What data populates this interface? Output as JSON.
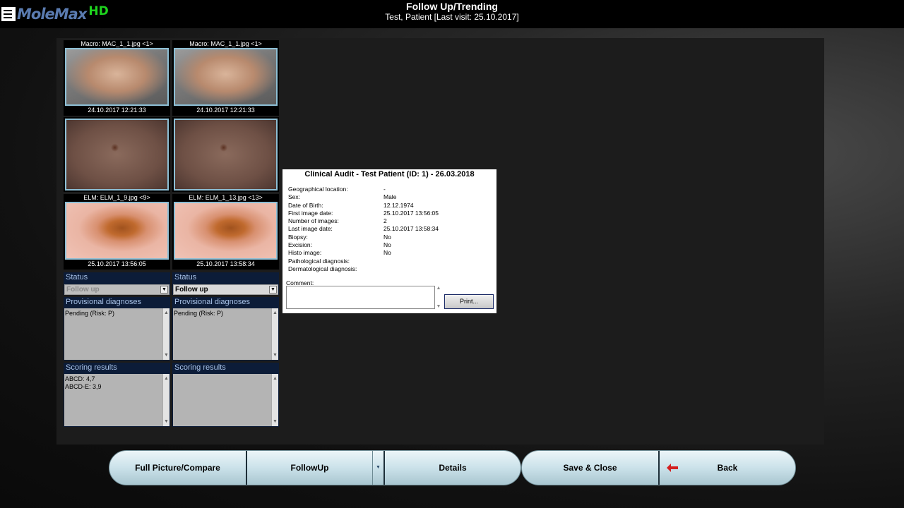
{
  "header": {
    "logo_text": "MoleMax",
    "logo_hd": "HD",
    "title": "Follow Up/Trending",
    "subtitle": "Test, Patient [Last visit: 25.10.2017]"
  },
  "columns": [
    {
      "macro_label": "Macro: MAC_1_1.jpg <1>",
      "macro_date": "24.10.2017 12:21:33",
      "elm_label": "ELM: ELM_1_9.jpg <9>",
      "elm_date": "25.10.2017 13:56:05",
      "status_heading": "Status",
      "status_value": "Follow up",
      "prov_heading": "Provisional diagnoses",
      "prov_text": "Pending (Risk: P)",
      "scoring_heading": "Scoring results",
      "scoring_lines": [
        "ABCD: 4,7",
        "ABCD-E: 3,9"
      ]
    },
    {
      "macro_label": "Macro: MAC_1_1.jpg <1>",
      "macro_date": "24.10.2017 12:21:33",
      "elm_label": "ELM: ELM_1_13.jpg <13>",
      "elm_date": "25.10.2017 13:58:34",
      "status_heading": "Status",
      "status_value": "Follow up",
      "prov_heading": "Provisional diagnoses",
      "prov_text": "Pending (Risk: P)",
      "scoring_heading": "Scoring results",
      "scoring_lines": [
        "",
        ""
      ]
    }
  ],
  "audit": {
    "title": "Clinical Audit - Test Patient (ID: 1) - 26.03.2018",
    "rows": [
      {
        "key": "Geographical location:",
        "value": "-"
      },
      {
        "key": "Sex:",
        "value": "Male"
      },
      {
        "key": "Date of Birth:",
        "value": "12.12.1974"
      },
      {
        "key": "First image date:",
        "value": "25.10.2017 13:56:05"
      },
      {
        "key": "Number of images:",
        "value": "2"
      },
      {
        "key": "Last image date:",
        "value": "25.10.2017 13:58:34"
      },
      {
        "key": "Biopsy:",
        "value": "No"
      },
      {
        "key": "Excision:",
        "value": "No"
      },
      {
        "key": "Histo image:",
        "value": "No"
      },
      {
        "key": "Pathological diagnosis:",
        "value": ""
      },
      {
        "key": "Dermatological diagnosis:",
        "value": ""
      }
    ],
    "comment_label": "Comment:",
    "print_label": "Print..."
  },
  "buttons": {
    "full_picture": "Full Picture/Compare",
    "followup": "FollowUp",
    "details": "Details",
    "save_close": "Save & Close",
    "back": "Back"
  },
  "colors": {
    "accent_frame": "#8ec0d6",
    "section_bg": "#0c1c38",
    "logo_hd": "#1ed41e",
    "back_arrow": "#d42020"
  }
}
